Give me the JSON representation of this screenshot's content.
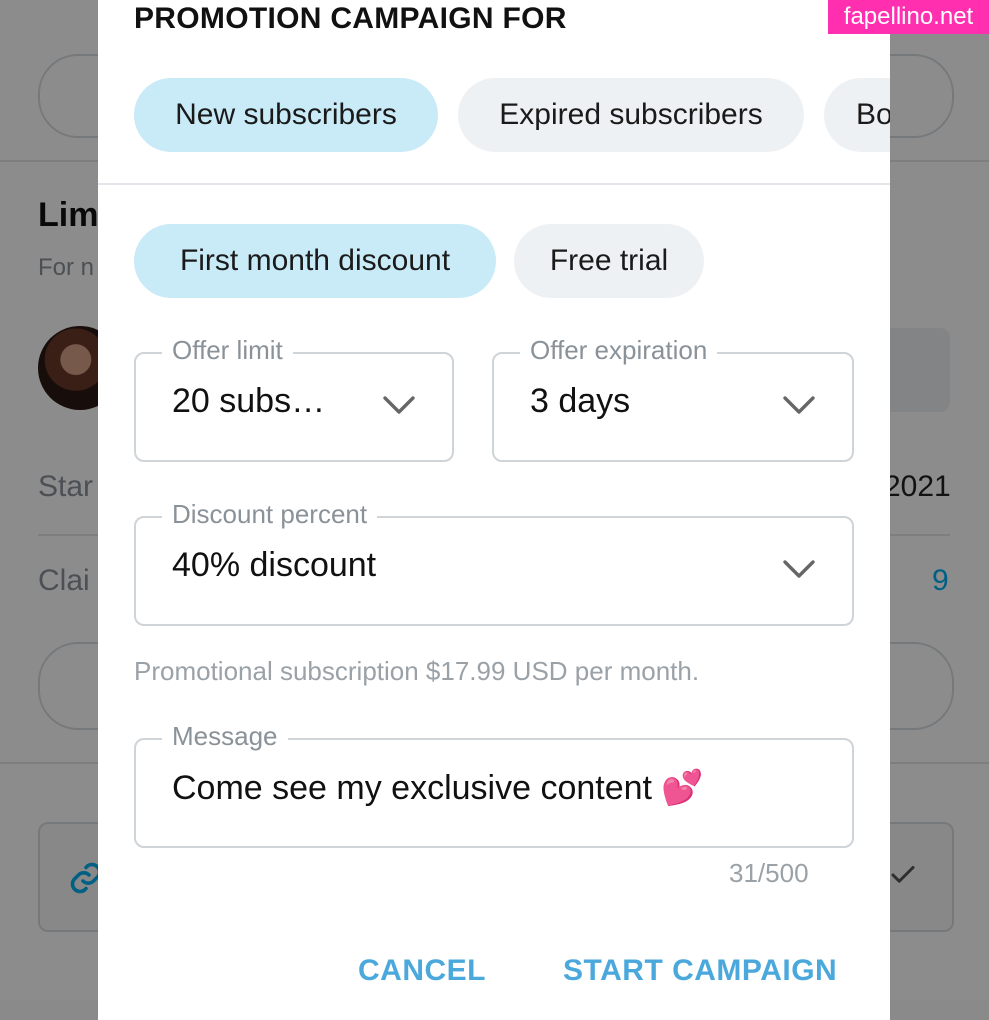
{
  "background": {
    "title": "Lim",
    "subtitle": "For n",
    "start_label": "Star",
    "start_value": "2021",
    "claimed_label": "Clai",
    "claimed_value": "9"
  },
  "modal": {
    "title": "PROMOTION CAMPAIGN FOR",
    "audience_chips": [
      {
        "label": "New subscribers",
        "selected": true
      },
      {
        "label": "Expired subscribers",
        "selected": false
      },
      {
        "label": "Bo",
        "selected": false
      }
    ],
    "offer_type_chips": [
      {
        "label": "First month discount",
        "selected": true
      },
      {
        "label": "Free trial",
        "selected": false
      }
    ],
    "offer_limit": {
      "label": "Offer limit",
      "value": "20 subs…"
    },
    "offer_expiration": {
      "label": "Offer expiration",
      "value": "3 days"
    },
    "discount_percent": {
      "label": "Discount percent",
      "value": "40% discount"
    },
    "help_text": "Promotional subscription $17.99 USD per month.",
    "message": {
      "label": "Message",
      "value": "Come see my exclusive content 💕",
      "counter": "31/500"
    },
    "cancel_label": "CANCEL",
    "start_label": "START CAMPAIGN"
  },
  "watermark": "fapellino.net",
  "colors": {
    "accent": "#4aa8dc",
    "chip_selected": "#c9ebf8",
    "chip": "#eef1f3",
    "watermark": "#ff2fb0"
  },
  "icons": {
    "dropdown": "chevron-down-icon",
    "link": "link-icon",
    "check": "check-icon"
  }
}
